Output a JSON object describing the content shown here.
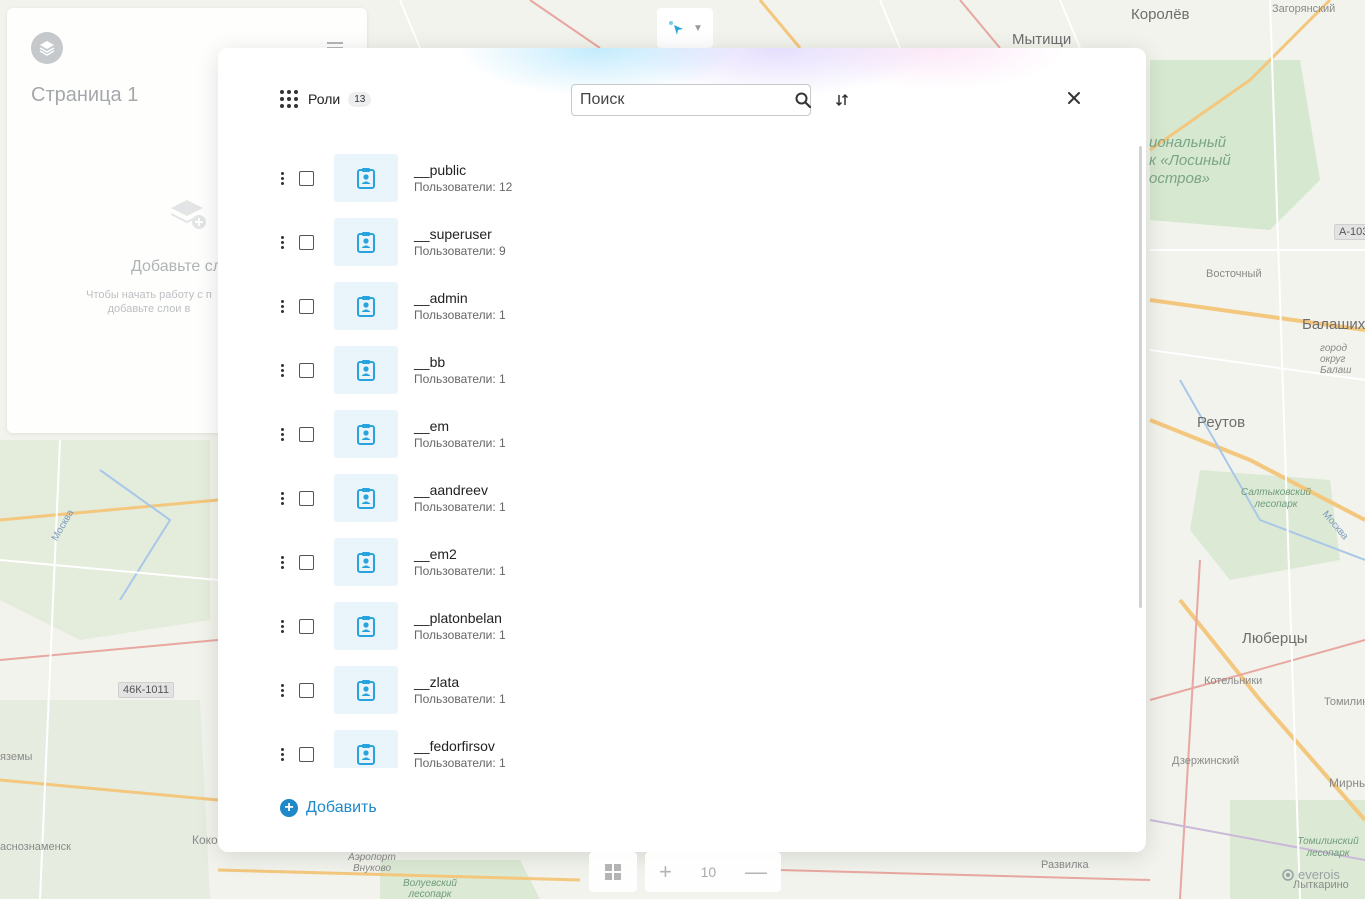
{
  "map": {
    "labels": [
      "Королёв",
      "Загорянский",
      "Мытищи",
      "Восточный",
      "Балашиха",
      "Реутов",
      "Люберцы",
      "Котельники",
      "Томилино",
      "Дзержинский",
      "Мирны",
      "Развилка",
      "Лыткарино",
      "Коко",
      "яземы",
      "аснознаменск",
      "Москва",
      "Москва"
    ],
    "park_labels": [
      "Салтыковский лесопарк",
      "Томилинский лесопарк",
      "Волуевский лесопарк",
      "Аэропорт Внуково",
      "город округ Балаш"
    ],
    "park_big": [
      "иональный",
      "к «Лосиный",
      "остров»"
    ],
    "road_badges": [
      "46К-1011",
      "А-103"
    ]
  },
  "left_panel": {
    "title": "Страница 1",
    "empty_title": "Добавьте сл",
    "empty_desc": "Чтобы начать работу с п добавьте слои в"
  },
  "bottom": {
    "zoom_level": "10",
    "zoom_in": "+",
    "zoom_out": "—",
    "attribution": "everois"
  },
  "modal": {
    "title": "Роли",
    "count": "13",
    "search_placeholder": "Поиск",
    "search_value": "",
    "add_label": "Добавить",
    "roles": [
      {
        "name": "__public",
        "users": "Пользователи: 12"
      },
      {
        "name": "__superuser",
        "users": "Пользователи: 9"
      },
      {
        "name": "__admin",
        "users": "Пользователи: 1"
      },
      {
        "name": "__bb",
        "users": "Пользователи: 1"
      },
      {
        "name": "__em",
        "users": "Пользователи: 1"
      },
      {
        "name": "__aandreev",
        "users": "Пользователи: 1"
      },
      {
        "name": "__em2",
        "users": "Пользователи: 1"
      },
      {
        "name": "__platonbelan",
        "users": "Пользователи: 1"
      },
      {
        "name": "__zlata",
        "users": "Пользователи: 1"
      },
      {
        "name": "__fedorfirsov",
        "users": "Пользователи: 1"
      }
    ]
  },
  "colors": {
    "accent": "#1e88c8",
    "thumb_bg": "#eaf5fb",
    "thumb_icon": "#29a3dc"
  }
}
